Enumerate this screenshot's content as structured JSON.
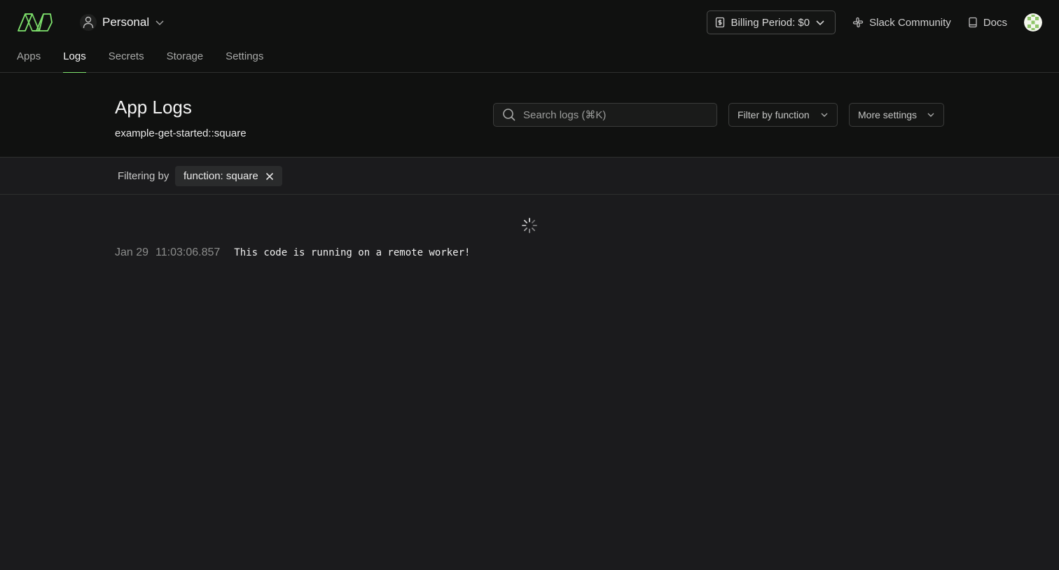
{
  "topbar": {
    "workspace": "Personal",
    "billing_label": "Billing Period: $0",
    "slack_label": "Slack Community",
    "docs_label": "Docs"
  },
  "tabs": [
    {
      "label": "Apps",
      "active": false
    },
    {
      "label": "Logs",
      "active": true
    },
    {
      "label": "Secrets",
      "active": false
    },
    {
      "label": "Storage",
      "active": false
    },
    {
      "label": "Settings",
      "active": false
    }
  ],
  "header": {
    "title": "App Logs",
    "subtitle": "example-get-started::square",
    "search_placeholder": "Search logs (⌘K)",
    "filter_label": "Filter by function",
    "more_label": "More settings"
  },
  "filter": {
    "label": "Filtering by",
    "chip": "function: square"
  },
  "logs": [
    {
      "date": "Jan 29",
      "time": "11:03:06.857",
      "message": "This code is running on a remote worker!"
    }
  ],
  "colors": {
    "accent": "#7fe36d",
    "background": "#1b1b1d",
    "topbar": "#101110"
  },
  "icons": [
    "modal-logo",
    "user-icon",
    "chevron-down-icon",
    "dollar-receipt-icon",
    "slack-icon",
    "book-icon",
    "avatar",
    "search-icon",
    "close-icon",
    "spinner-icon"
  ]
}
